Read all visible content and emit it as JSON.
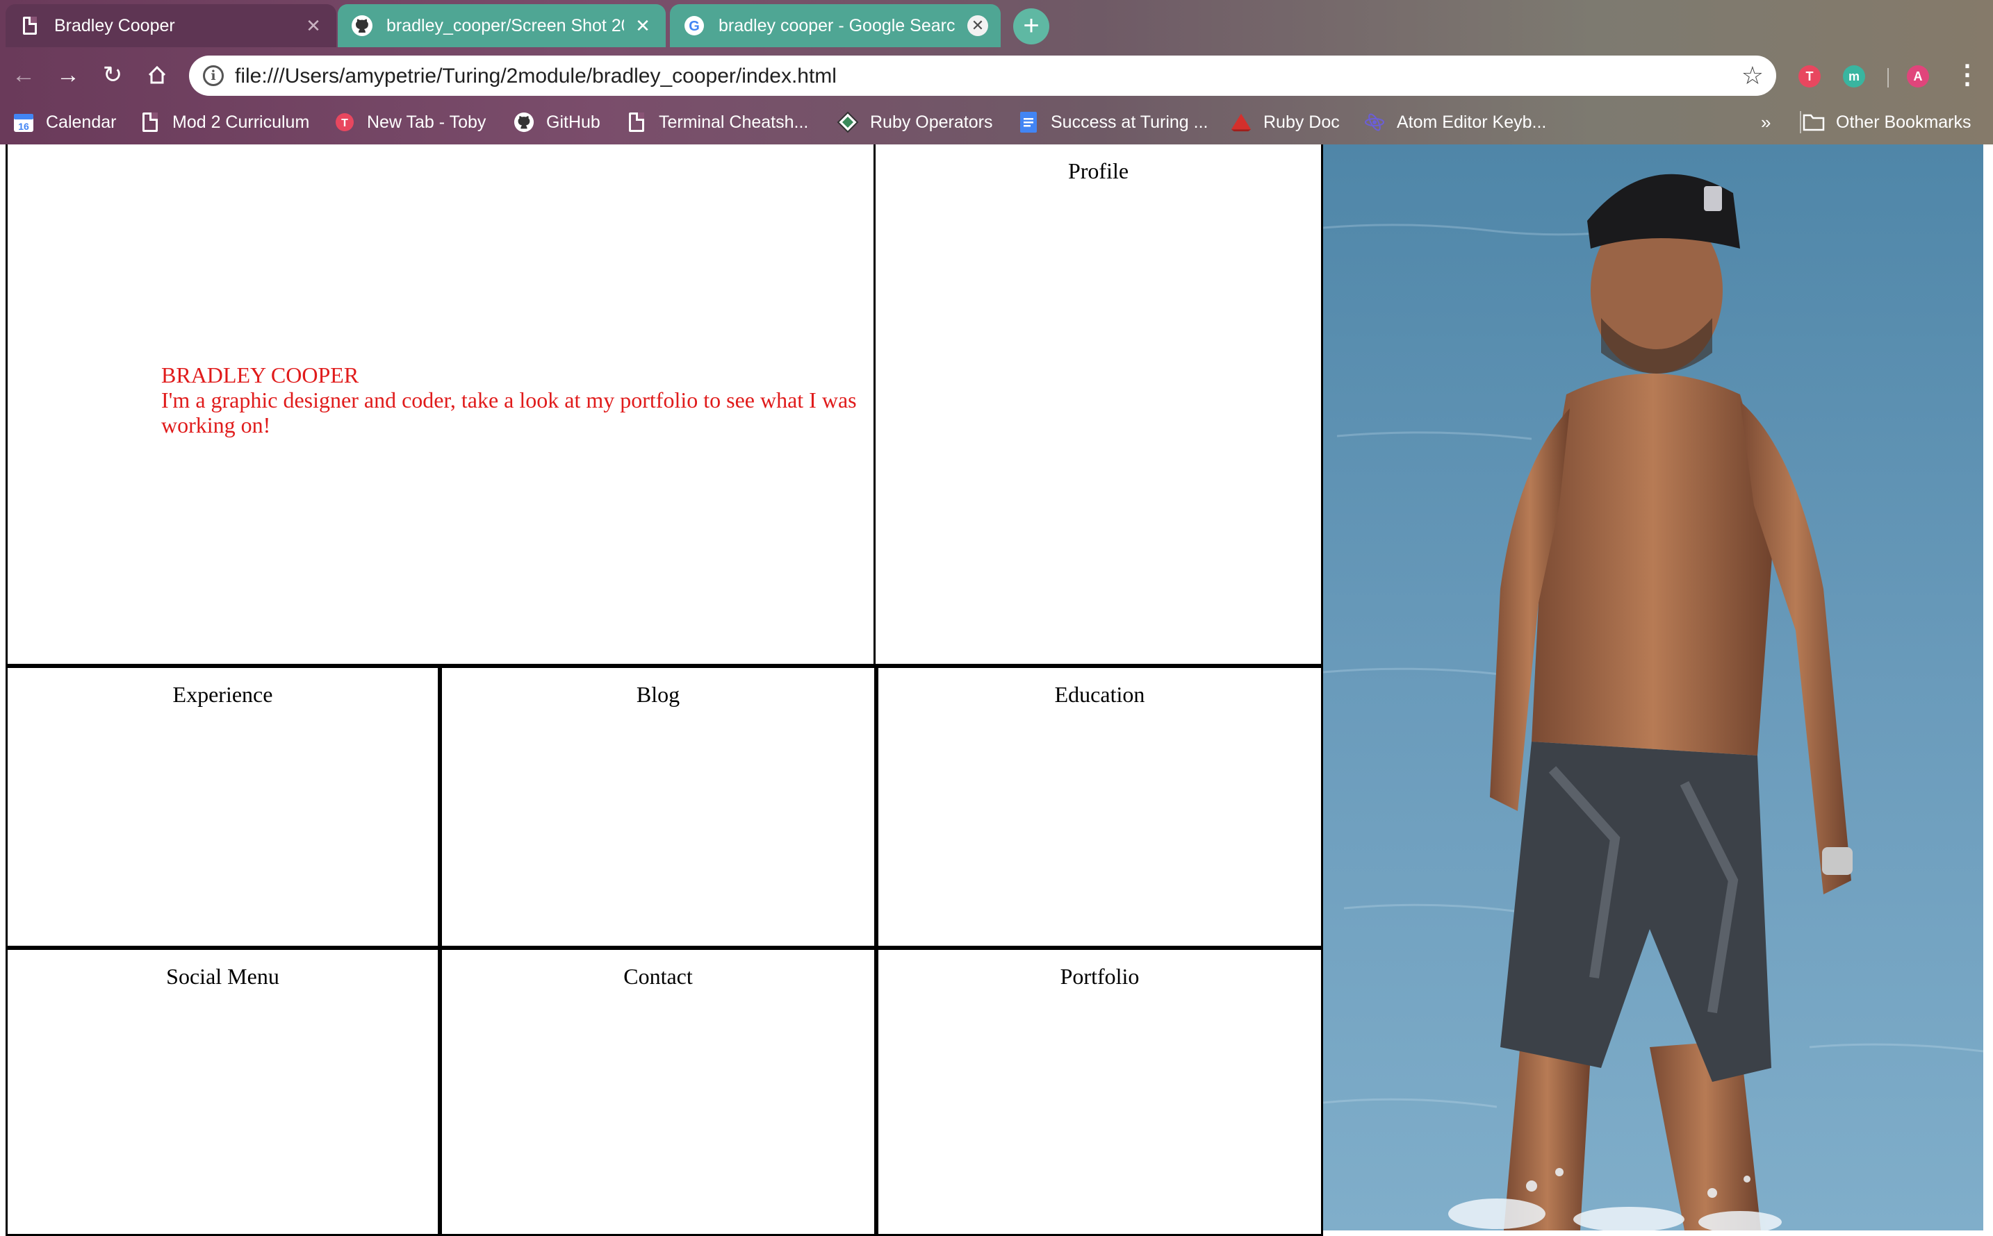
{
  "browser": {
    "tabs": [
      {
        "title": "Bradley Cooper",
        "icon": "document-icon",
        "active": true
      },
      {
        "title": "bradley_cooper/Screen Shot 20",
        "icon": "github-icon",
        "active": false
      },
      {
        "title": "bradley cooper - Google Searc",
        "icon": "google-icon",
        "active": false
      }
    ],
    "new_tab_label": "+",
    "url": "file:///Users/amypetrie/Turing/2module/bradley_cooper/index.html",
    "extensions": [
      {
        "label": "T",
        "color": "#e8475f"
      },
      {
        "label": "m",
        "color": "#39b5a0"
      },
      {
        "label": "A",
        "color": "#e0457b"
      }
    ],
    "bookmarks": [
      {
        "label": "Calendar",
        "icon": "calendar-icon"
      },
      {
        "label": "Mod 2 Curriculum",
        "icon": "document-icon"
      },
      {
        "label": "New Tab - Toby",
        "icon": "toby-icon"
      },
      {
        "label": "GitHub",
        "icon": "github-icon"
      },
      {
        "label": "Terminal Cheatsh...",
        "icon": "document-icon"
      },
      {
        "label": "Ruby Operators",
        "icon": "ruby-operators-icon"
      },
      {
        "label": "Success at Turing ...",
        "icon": "google-docs-icon"
      },
      {
        "label": "Ruby Doc",
        "icon": "ruby-icon"
      },
      {
        "label": "Atom Editor Keyb...",
        "icon": "atom-icon"
      }
    ],
    "bookmarks_overflow": "»",
    "other_bookmarks": "Other Bookmarks",
    "calendar_day": "16"
  },
  "page": {
    "intro": {
      "name": "BRADLEY COOPER",
      "tagline": "I'm a graphic designer and coder, take a look at my portfolio to see what I was working on!"
    },
    "sections": {
      "profile": "Profile",
      "experience": "Experience",
      "blog": "Blog",
      "education": "Education",
      "social": "Social Menu",
      "contact": "Contact",
      "portfolio": "Portfolio"
    },
    "text_color": "#e01b1b"
  }
}
